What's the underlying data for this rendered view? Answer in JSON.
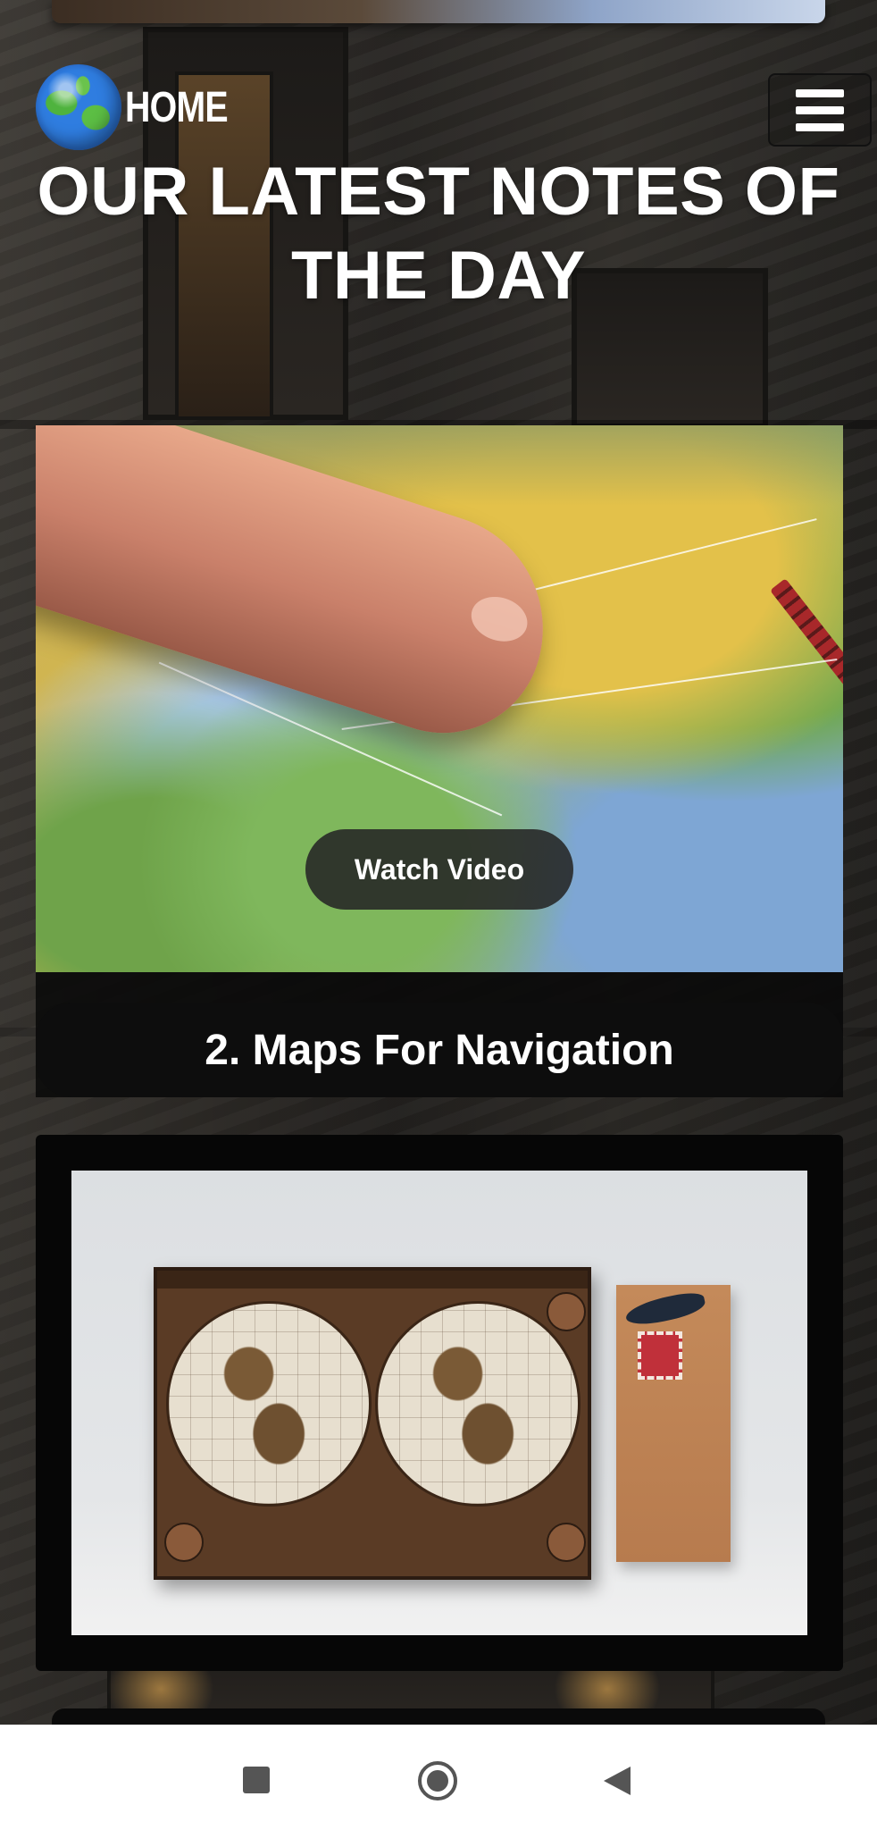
{
  "header": {
    "brand_label": "HOME",
    "page_title": "OUR LATEST NOTES OF THE DAY"
  },
  "cards": [
    {
      "watch_label": "Watch Video",
      "caption": "2. Maps For Navigation"
    }
  ],
  "colors": {
    "caption_bg": "#0d0d0d",
    "watch_button_bg": "#262626",
    "title_text": "#ffffff",
    "navbar_bg": "#ffffff",
    "navbar_icons": "#555555"
  },
  "icons": {
    "brand": "globe-icon",
    "menu": "hamburger-menu-icon",
    "nav_recent": "square-icon",
    "nav_home": "circle-icon",
    "nav_back": "triangle-back-icon"
  }
}
